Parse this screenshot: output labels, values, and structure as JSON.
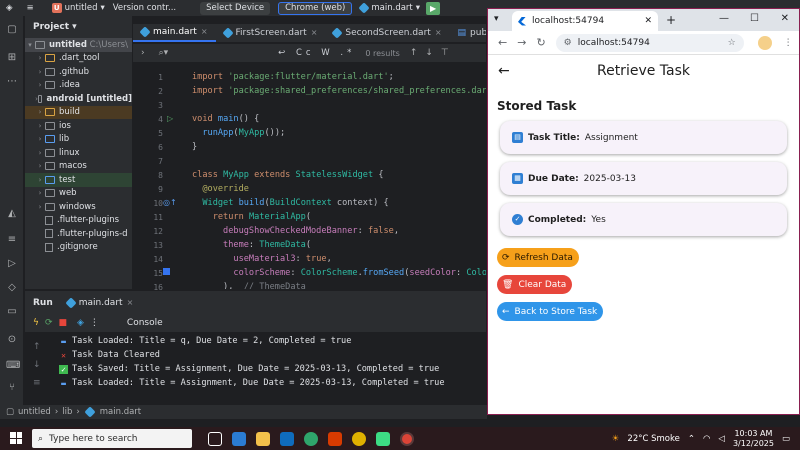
{
  "ide": {
    "project_name": "untitled",
    "vcs": "Version contr...",
    "device": "Select Device",
    "browser": "Chrome (web)",
    "run_config": "main.dart",
    "project_panel_title": "Project",
    "tree": [
      {
        "name": "untitled",
        "extra": "C:\\Users\\",
        "kind": "root"
      },
      {
        "name": ".dart_tool",
        "kind": "folder-orange"
      },
      {
        "name": ".github",
        "kind": "folder"
      },
      {
        "name": ".idea",
        "kind": "folder"
      },
      {
        "name": "android [untitled]",
        "kind": "folder"
      },
      {
        "name": "build",
        "kind": "folder-orange"
      },
      {
        "name": "ios",
        "kind": "folder"
      },
      {
        "name": "lib",
        "kind": "folder-blue"
      },
      {
        "name": "linux",
        "kind": "folder"
      },
      {
        "name": "macos",
        "kind": "folder"
      },
      {
        "name": "test",
        "kind": "folder-blue"
      },
      {
        "name": "web",
        "kind": "folder"
      },
      {
        "name": "windows",
        "kind": "folder"
      },
      {
        "name": ".flutter-plugins",
        "kind": "file"
      },
      {
        "name": ".flutter-plugins-d",
        "kind": "file"
      },
      {
        "name": ".gitignore",
        "kind": "file"
      }
    ],
    "tabs": [
      "main.dart",
      "FirstScreen.dart",
      "SecondScreen.dart",
      "pubspec.ya"
    ],
    "find": {
      "results": "0 results",
      "tools": "Cc W .*"
    },
    "line_numbers": [
      "1",
      "2",
      "3",
      "4",
      "5",
      "6",
      "7",
      "8",
      "9",
      "10",
      "11",
      "12",
      "13",
      "14",
      "15",
      "16"
    ],
    "run_title": "Run",
    "run_tab": "main.dart",
    "console_label": "Console",
    "console": [
      {
        "mark": "info",
        "text": "Task Loaded: Title = q, Due Date = 2, Completed = true"
      },
      {
        "mark": "error",
        "text": "Task Data Cleared"
      },
      {
        "mark": "ok",
        "text": "Task Saved: Title = Assignment, Due Date = 2025-03-13, Completed = true"
      },
      {
        "mark": "info",
        "text": "Task Loaded: Title = Assignment, Due Date = 2025-03-13, Completed = true"
      }
    ],
    "breadcrumb": [
      "untitled",
      "lib",
      "main.dart"
    ]
  },
  "browser": {
    "tab_title": "localhost:54794",
    "url": "localhost:54794"
  },
  "app": {
    "title": "Retrieve Task",
    "section": "Stored Task",
    "cards": [
      {
        "key": "Task Title:",
        "value": "Assignment",
        "icon": "document-icon"
      },
      {
        "key": "Due Date:",
        "value": "2025-03-13",
        "icon": "calendar-icon"
      },
      {
        "key": "Completed:",
        "value": "Yes",
        "icon": "check-circle-icon"
      }
    ],
    "buttons": {
      "refresh": "Refresh Data",
      "clear": "Clear Data",
      "back": "Back to Store Task"
    }
  },
  "taskbar": {
    "search_placeholder": "Type here to search",
    "weather": "22°C  Smoke",
    "time": "10:03 AM",
    "date": "3/12/2025"
  },
  "colors": {
    "ide_bg": "#1e1f22",
    "accent": "#3574f0",
    "refresh": "#f6a01a",
    "clear": "#e7463b",
    "back": "#2f95e9"
  }
}
